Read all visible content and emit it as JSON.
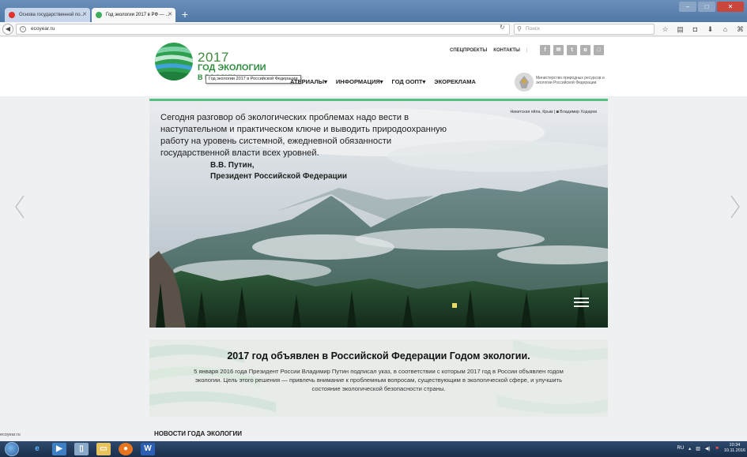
{
  "browser": {
    "tabs": [
      {
        "label": "Основа государственной по...",
        "active": false
      },
      {
        "label": "Год экологии 2017 в РФ — ...",
        "active": true
      }
    ],
    "new_tab": "+",
    "url": "ecoyear.ru",
    "search_placeholder": "Поиск",
    "status_url": "ecoyear.ru"
  },
  "header": {
    "logo_year": "2017",
    "logo_title": "ГОД ЭКОЛОГИИ",
    "logo_sub": "В РОССИИ",
    "tooltip": "Год экологии 2017 в Российской Федерации",
    "main_nav": [
      "АТЕРИАЛЫ▾",
      "ИНФОРМАЦИЯ▾",
      "ГОД ООПТ▾",
      "ЭКОРЕКЛАМА"
    ],
    "top_nav": [
      "СПЕЦПРОЕКТЫ",
      "КОНТАКТЫ"
    ],
    "top_nav_sep": "|",
    "social": [
      "f",
      "✉",
      "t",
      "в",
      "□"
    ],
    "ministry": "Министерство природных ресурсов и экологии Российской Федерации"
  },
  "hero": {
    "quote": "Сегодня разговор об экологических проблемах надо вести в наступательном и практическом ключе и выводить природоохранную работу на уровень системной, ежедневной обязанности государственной власти всех уровней.",
    "author_name": "В.В. Путин,",
    "author_title": "Президент Российской Федерации",
    "credit": "Никитская яйла, Крым | ◙ Владимир Ходарев"
  },
  "announcement": {
    "title": "2017 год объявлен в Российской Федерации Годом экологии.",
    "text": "5 января 2016 года Президент России Владимир Путин подписал указ, в соответствии с которым 2017 год в России объявлен годом экологии. Цель этого решения — привлечь внимание к проблемным вопросам, существующим в экологической сфере, и улучшить состояние экологической безопасности страны."
  },
  "news_heading": "НОВОСТИ ГОДА ЭКОЛОГИИ",
  "taskbar": {
    "lang": "RU",
    "time": "10:34",
    "date": "10.11.2016"
  },
  "colors": {
    "brand_green": "#2b8c3b",
    "accent_line": "#56c083"
  }
}
